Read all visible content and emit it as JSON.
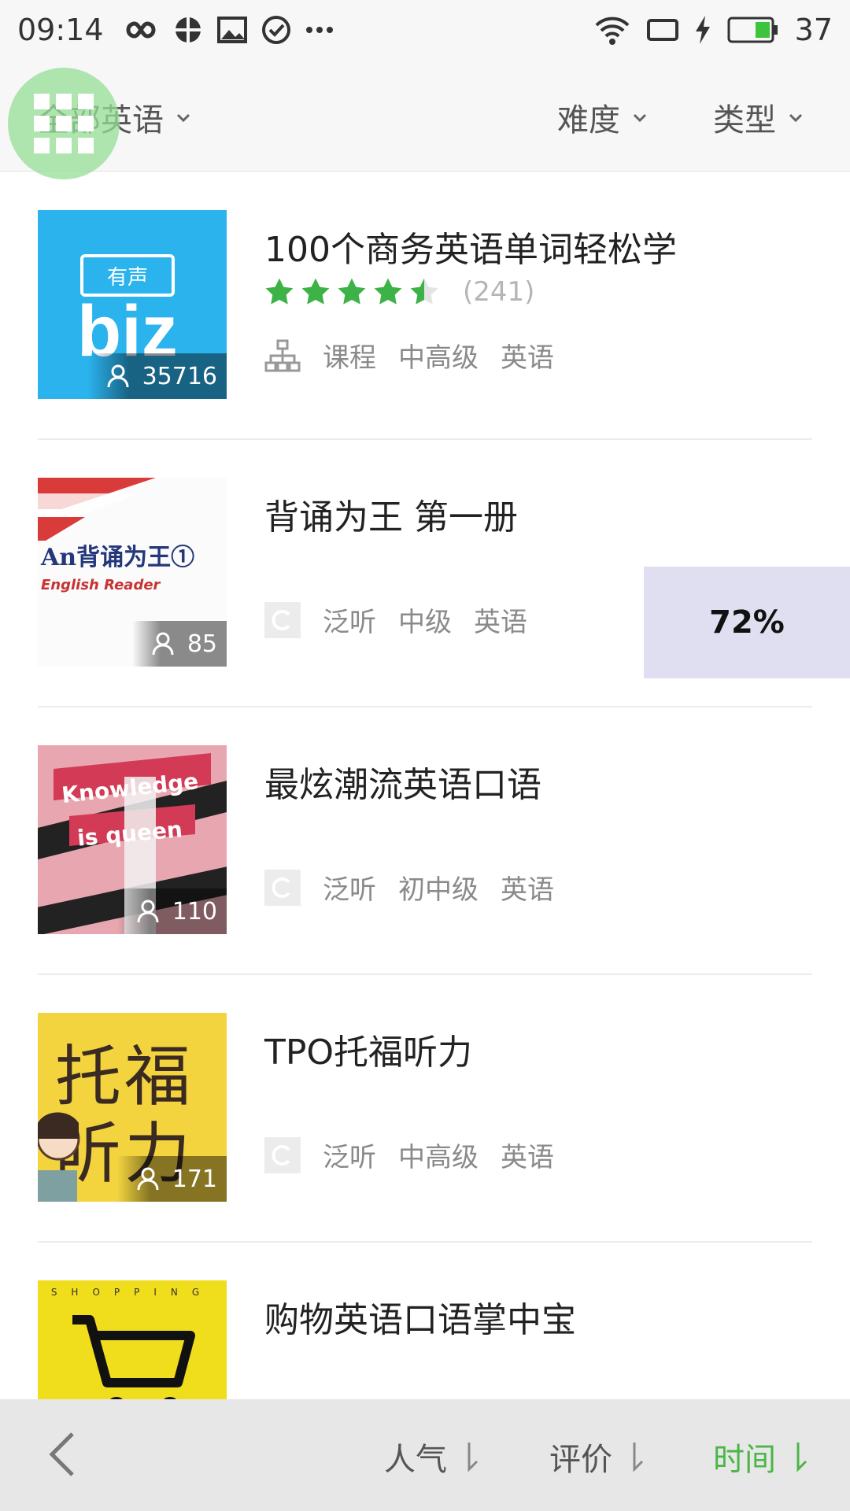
{
  "status_bar": {
    "time": "09:14",
    "battery": "37"
  },
  "filters": {
    "category": "全部英语",
    "difficulty": "难度",
    "type": "类型"
  },
  "items": [
    {
      "title": "100个商务英语单词轻松学",
      "listeners": "35716",
      "rating_count": "(241)",
      "rating": 4.5,
      "tags": [
        "课程",
        "中高级",
        "英语"
      ],
      "cover_color": "#2bb3ee",
      "cover_text_top": "有声",
      "cover_text_main": "biz"
    },
    {
      "title": "背诵为王 第一册",
      "listeners": "85",
      "tags": [
        "泛听",
        "中级",
        "英语"
      ],
      "cover_line1": "An背诵为王①",
      "cover_line2": "English Reader"
    },
    {
      "title": "最炫潮流英语口语",
      "listeners": "110",
      "tags": [
        "泛听",
        "初中级",
        "英语"
      ],
      "cover_line1": "Knowledge",
      "cover_line2": "is queen"
    },
    {
      "title": "TPO托福听力",
      "listeners": "171",
      "tags": [
        "泛听",
        "中高级",
        "英语"
      ],
      "cover_line1": "托福",
      "cover_line2": "听力"
    },
    {
      "title": "购物英语口语掌中宝",
      "cover_text": "SHOPPING"
    }
  ],
  "progress_badge": "72%",
  "sort_bar": {
    "popularity": "人气",
    "rating": "评价",
    "time": "时间"
  },
  "colors": {
    "accent_green": "#4cb648",
    "star_green": "#3db246"
  }
}
